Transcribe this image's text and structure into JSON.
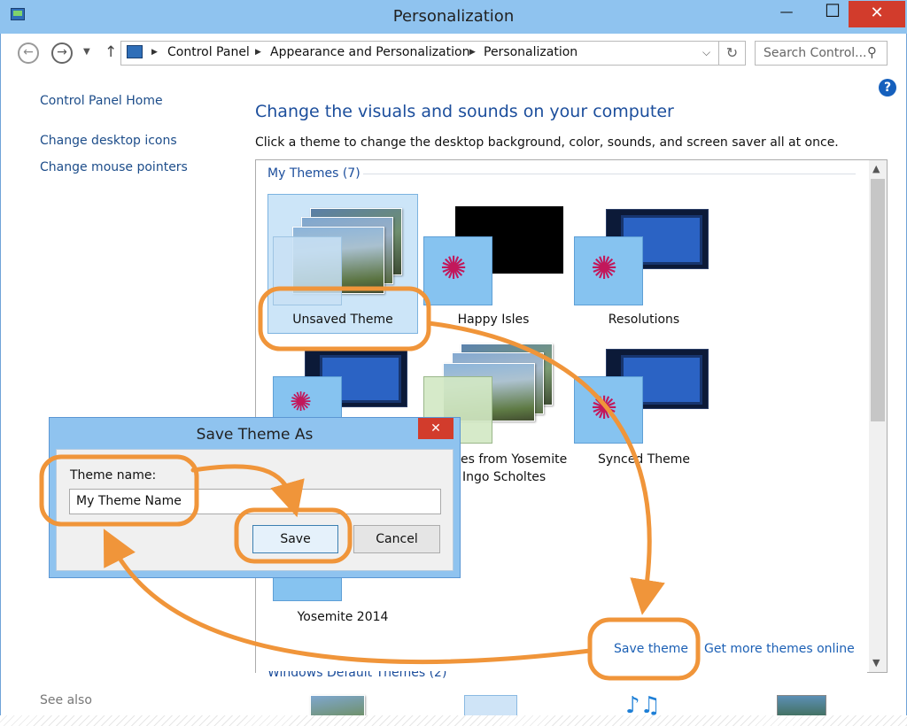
{
  "window": {
    "title": "Personalization",
    "minimize": "—",
    "maximize": "☐",
    "close": "✕"
  },
  "navbar": {
    "back_icon": "back-arrow-icon",
    "forward_icon": "forward-arrow-icon",
    "breadcrumbs": [
      "Control Panel",
      "Appearance and Personalization",
      "Personalization"
    ],
    "search_placeholder": "Search Control..."
  },
  "sidebar": {
    "items": [
      {
        "label": "Control Panel Home"
      },
      {
        "label": "Change desktop icons"
      },
      {
        "label": "Change mouse pointers"
      }
    ],
    "see_also": "See also"
  },
  "help_label": "?",
  "main": {
    "heading": "Change the visuals and sounds on your computer",
    "subtitle": "Click a theme to change the desktop background, color, sounds, and screen saver all at once.",
    "group_my_themes": "My Themes (7)",
    "themes": [
      {
        "label": "Unsaved Theme",
        "selected": true
      },
      {
        "label": "Happy Isles"
      },
      {
        "label": "Resolutions"
      },
      {
        "label_line1": "es from Yosemite",
        "label_line2": "Ingo Scholtes"
      },
      {
        "label": "Synced Theme"
      },
      {
        "label": "Yosemite 2014"
      }
    ],
    "save_theme_link": "Save theme",
    "get_more_link": "Get more themes online",
    "group_windows_defaults": "Windows Default Themes (2)"
  },
  "dialog": {
    "title": "Save Theme As",
    "close": "✕",
    "field_label": "Theme name:",
    "field_value": "My Theme Name",
    "save_label": "Save",
    "cancel_label": "Cancel"
  },
  "colors": {
    "accent_orange": "#f0953a",
    "link_blue": "#1c60b5",
    "heading_blue": "#1c4e9c",
    "titlebar_blue": "#8fc3ef",
    "close_red": "#d23c2c"
  }
}
